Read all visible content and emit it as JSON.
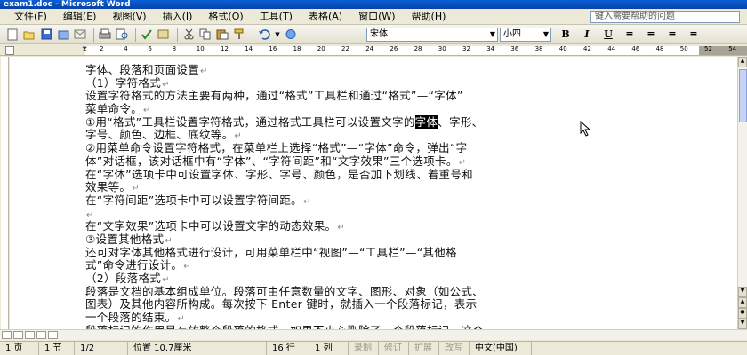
{
  "window": {
    "title": "exam1.doc - Microsoft Word"
  },
  "menu": {
    "items": [
      "文件(F)",
      "编辑(E)",
      "视图(V)",
      "插入(I)",
      "格式(O)",
      "工具(T)",
      "表格(A)",
      "窗口(W)",
      "帮助(H)"
    ],
    "help_placeholder": "键入需要帮助的问题"
  },
  "toolbar": {
    "font": "宋体",
    "size": "小四",
    "icons": [
      "new-icon",
      "open-icon",
      "save-icon",
      "permission-icon",
      "email-icon",
      "print-icon",
      "print-preview-icon",
      "spelling-icon",
      "research-icon",
      "cut-icon",
      "copy-icon",
      "paste-icon",
      "format-painter-icon",
      "undo-icon",
      "hyperlink-icon"
    ],
    "format_buttons": [
      "B",
      "I",
      "U",
      "≡",
      "≡",
      "≡",
      "≡"
    ]
  },
  "ruler": {
    "numbers": [
      "2",
      "4",
      "6",
      "8",
      "10",
      "12",
      "14",
      "16",
      "18",
      "20",
      "22",
      "24",
      "26",
      "28",
      "30",
      "32",
      "34",
      "36",
      "38",
      "40",
      "42",
      "44",
      "46",
      "48",
      "50",
      "52",
      "54"
    ]
  },
  "document": {
    "lines": [
      {
        "text": "字体、段落和页面设置",
        "mark": "↵"
      },
      {
        "text": "（1）字符格式",
        "mark": "↵"
      },
      {
        "text": "设置字符格式的方法主要有两种，通过“格式”工具栏和通过“格式”—“字体”",
        "mark": ""
      },
      {
        "text": "菜单命令。",
        "mark": "↵"
      },
      {
        "text_before": "①用“格式”工具栏设置字符格式，通过格式工具栏可以设置文字的",
        "selected": "字体",
        "text_after": "、字形、",
        "mark": ""
      },
      {
        "text": "字号、颜色、边框、底纹等。",
        "mark": "↵"
      },
      {
        "text": "②用菜单命令设置字符格式，在菜单栏上选择“格式”—“字体”命令，弹出“字",
        "mark": ""
      },
      {
        "text": "体”对话框，该对话框中有“字体”、“字符间距”和“文字效果”三个选项卡。",
        "mark": "↵"
      },
      {
        "text": "在“字体”选项卡中可设置字体、字形、字号、颜色，是否加下划线、着重号和",
        "mark": ""
      },
      {
        "text": "效果等。",
        "mark": "↵"
      },
      {
        "text": "在“字符间距”选项卡中可以设置字符间距。",
        "mark": "↵"
      },
      {
        "text": "",
        "mark": "↵"
      },
      {
        "text": "在“文字效果”选项卡中可以设置文字的动态效果。",
        "mark": "↵"
      },
      {
        "text": "③设置其他格式",
        "mark": "↵"
      },
      {
        "text": "还可对字体其他格式进行设计，可用菜单栏中“视图”—“工具栏”—“其他格",
        "mark": ""
      },
      {
        "text": "式”命令进行设计。",
        "mark": "↵"
      },
      {
        "text": "（2）段落格式",
        "mark": "↵"
      },
      {
        "text": "段落是文档的基本组成单位。段落可由任意数量的文字、图形、对象（如公式、",
        "mark": ""
      },
      {
        "text": "图表）及其他内容所构成。每次按下 Enter 键时，就插入一个段落标记，表示",
        "mark": ""
      },
      {
        "text": "一个段落的结束。",
        "mark": "↵"
      },
      {
        "text": "段落标记的作用是存放整个段落的格式，如果不小心删除了一个段落标记，这个",
        "mark": ""
      }
    ]
  },
  "status": {
    "page": "1 页",
    "section": "1 节",
    "pages": "1/2",
    "position": "位置 10.7厘米",
    "line": "16 行",
    "column": "1 列",
    "rec": "录制",
    "trk": "修订",
    "ext": "扩展",
    "ovr": "改写",
    "language": "中文(中国)"
  }
}
